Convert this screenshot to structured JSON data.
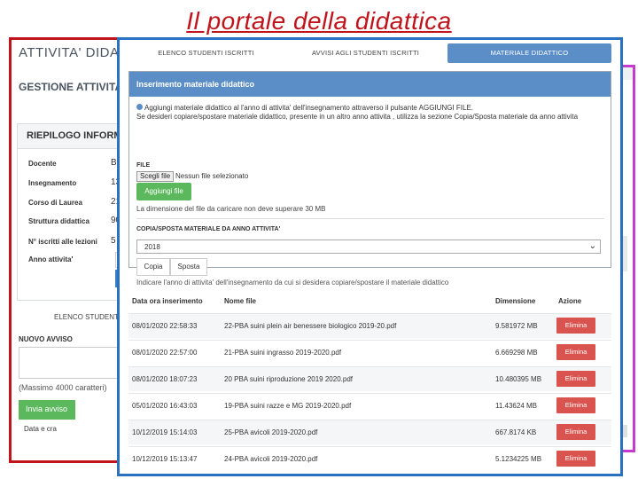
{
  "slide_title": "Il portale della didattica",
  "back_panel": {
    "app_title": "ATTIVITA' DIDAT",
    "section_title": "GESTIONE ATTIVITA",
    "summary_header": "RIEPILOGO INFORMA",
    "summary_rows": [
      {
        "label": "Docente",
        "value": "BI"
      },
      {
        "label": "Insegnamento",
        "value": "13"
      },
      {
        "label": "Corso di Laurea",
        "value": "21"
      },
      {
        "label": "Struttura didattica",
        "value": "90"
      },
      {
        "label": "N° iscritti alle lezioni",
        "value": "5"
      },
      {
        "label": "Anno attivita'",
        "value": ""
      }
    ],
    "tab_partial": "ELENCO STUDENT",
    "new_notice_label": "NUOVO AVVISO",
    "max_chars_note": "(Massimo 4000 caratteri)",
    "send_button": "Invia avviso",
    "date_column": "Data e cra",
    "col_hint": "A"
  },
  "tabs": [
    {
      "label": "ELENCO STUDENTI ISCRITTI",
      "active": false
    },
    {
      "label": "AVVISI AGLI STUDENTI ISCRITTI",
      "active": false
    },
    {
      "label": "MATERIALE DIDATTICO",
      "active": true
    }
  ],
  "insert_section": {
    "header": "Inserimento materiale didattico",
    "info_line1": "Aggiungi materiale didattico al l'anno di attivita' dell'insegnamento attraverso il pulsante AGGIUNGI FILE.",
    "info_line2": "Se desideri copiare/spostare materiale didattico, presente in un altro anno attivita , utilizza la sezione Copia/Sposta materiale da anno attivita",
    "file_label": "FILE",
    "choose_button": "Scegli file",
    "no_file_text": "Nessun file selezionato",
    "add_button": "Aggiungi file",
    "size_note": "La dimensione del file da caricare non deve superare 30 MB",
    "copy_label": "COPIA/SPOSTA MATERIALE DA ANNO ATTIVITA'",
    "year_selected": "2018",
    "copy_button": "Copia",
    "move_button": "Sposta",
    "hint_note": "Indicare l'anno di attivita' dell'insegnamento da cui si desidera copiare/spostare il materiale didattico"
  },
  "files_table": {
    "headers": [
      "Data ora inserimento",
      "Nome file",
      "Dimensione",
      "Azione"
    ],
    "rows": [
      {
        "date": "08/01/2020 22:58:33",
        "name": "22-PBA suini plein air benessere biologico 2019-20.pdf",
        "size": "9.581972 MB",
        "action": "Elimina"
      },
      {
        "date": "08/01/2020 22:57:00",
        "name": "21-PBA suini ingrasso 2019-2020.pdf",
        "size": "6.669298 MB",
        "action": "Elimina"
      },
      {
        "date": "08/01/2020 18:07:23",
        "name": "20 PBA suini riproduzione 2019 2020.pdf",
        "size": "10.480395 MB",
        "action": "Elimina"
      },
      {
        "date": "05/01/2020 16:43:03",
        "name": "19-PBA suini razze e MG 2019-2020.pdf",
        "size": "11.43624 MB",
        "action": "Elimina"
      },
      {
        "date": "10/12/2019 15:14:03",
        "name": "25-PBA avicoli 2019-2020.pdf",
        "size": "667.8174 KB",
        "action": "Elimina"
      },
      {
        "date": "10/12/2019 15:13:47",
        "name": "24-PBA avicoli 2019-2020.pdf",
        "size": "5.1234225 MB",
        "action": "Elimina"
      }
    ]
  },
  "colors": {
    "title_red": "#c0141c",
    "panel_blue": "#2a72c1",
    "panel_magenta": "#c63ad0",
    "header_blue": "#5b8ec7",
    "green_button": "#5cb85c",
    "red_button": "#d9534f"
  }
}
